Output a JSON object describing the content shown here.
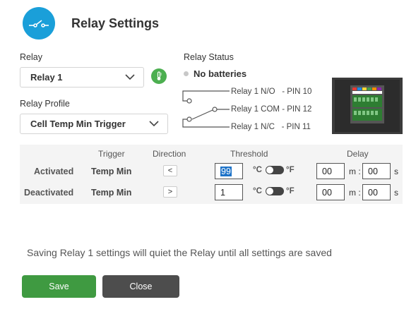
{
  "header": {
    "title": "Relay Settings",
    "icon": "relay-switch-icon"
  },
  "relay": {
    "label": "Relay",
    "selected": "Relay 1"
  },
  "profile": {
    "label": "Relay Profile",
    "selected": "Cell Temp Min Trigger"
  },
  "status": {
    "label": "Relay Status",
    "text": "No batteries",
    "pins": [
      "Relay 1 N/O   - PIN 10",
      "Relay 1 COM - PIN 12",
      "Relay 1 N/C   - PIN 11"
    ]
  },
  "table": {
    "headers": {
      "trigger": "Trigger",
      "direction": "Direction",
      "threshold": "Threshold",
      "delay": "Delay"
    },
    "rows": [
      {
        "label": "Activated",
        "trigger": "Temp Min",
        "direction": "<",
        "threshold": "99",
        "unit_c": "°C",
        "unit_f": "°F",
        "delay_m": "00",
        "m_label": "m :",
        "delay_s": "00",
        "s_label": "s"
      },
      {
        "label": "Deactivated",
        "trigger": "Temp Min",
        "direction": ">",
        "threshold": "1",
        "unit_c": "°C",
        "unit_f": "°F",
        "delay_m": "00",
        "m_label": "m :",
        "delay_s": "00",
        "s_label": "s"
      }
    ]
  },
  "notice": "Saving Relay 1 settings will quiet the Relay until all settings are saved",
  "buttons": {
    "save": "Save",
    "close": "Close"
  },
  "colors": {
    "accent": "#1a9fd9",
    "save": "#3f9a41",
    "close": "#4d4d4d",
    "thermometer": "#4caf50"
  }
}
